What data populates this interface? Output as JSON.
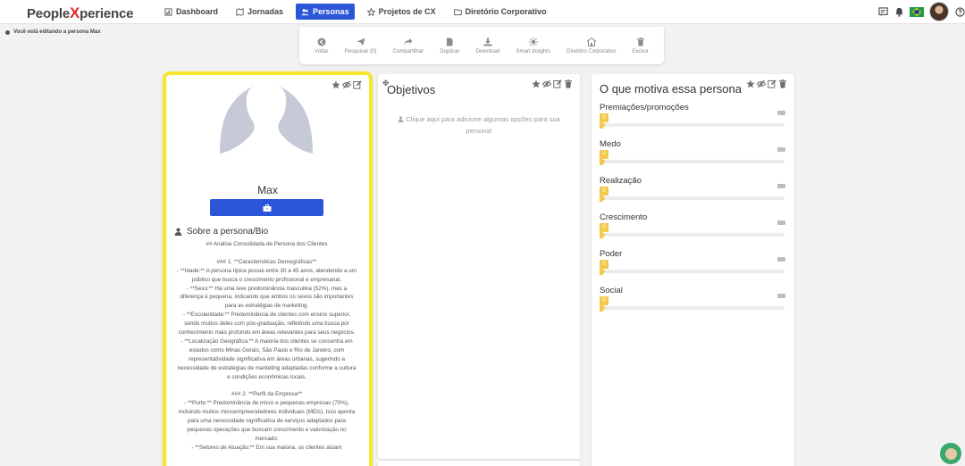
{
  "app": {
    "logo_part1": "People",
    "logo_x": "X",
    "logo_part2": "perience"
  },
  "nav": {
    "items": [
      {
        "label": "Dashboard",
        "icon": "dashboard-icon"
      },
      {
        "label": "Jornadas",
        "icon": "map-icon"
      },
      {
        "label": "Personas",
        "icon": "users-icon",
        "active": true
      },
      {
        "label": "Projetos de CX",
        "icon": "cx-icon"
      },
      {
        "label": "Diretório Corporativo",
        "icon": "folder-icon"
      }
    ]
  },
  "status": {
    "editing_text": "Você está editando a persona Max"
  },
  "toolbar": {
    "items": [
      {
        "label": "Voltar",
        "icon": "back-icon"
      },
      {
        "label": "Pesquisar (0)",
        "icon": "send-icon"
      },
      {
        "label": "Compartilhar",
        "icon": "share-icon"
      },
      {
        "label": "Duplicar",
        "icon": "duplicate-icon"
      },
      {
        "label": "Download",
        "icon": "download-icon"
      },
      {
        "label": "Smart Insights",
        "icon": "insights-icon"
      },
      {
        "label": "Diretório Corporativo",
        "icon": "directory-icon"
      },
      {
        "label": "Excluir",
        "icon": "trash-icon"
      }
    ]
  },
  "persona": {
    "name": "Max",
    "bio_heading": "Sobre a persona/Bio",
    "bio_text": "## Análise Consolidada de Persona dos Clientes\n\n### 1. **Características Demográficas**\n- **Idade:** A persona típica possui entre 30 a 45 anos, atendendo a um público que busca o crescimento profissional e empresarial.\n- **Sexo:** Há uma leve predominância masculina (52%), mas a diferença é pequena, indicando que ambos os sexos são importantes para as estratégias de marketing.\n- **Escolaridade:** Predominância de clientes com ensino superior, sendo muitos deles com pós-graduação, refletindo uma busca por conhecimento mais profundo em áreas relevantes para seus negócios.\n- **Localização Geográfica:** A maioria dos clientes se concentra em estados como Minas Gerais, São Paulo e Rio de Janeiro, com representatividade significativa em áreas urbanas, sugerindo a necessidade de estratégias de marketing adaptadas conforme a cultura e condições econômicas locais.\n\n### 2. **Perfil da Empresa**\n- **Porte:** Predominância de micro e pequenas empresas (70%), incluindo muitos microempreendedores individuais (MEIs). Isso aponta para uma necessidade significativa de serviços adaptados para pequenas operações que buscam crescimento e valorização no mercado.\n- **Setores de Atuação:** Em sua maioria, os clientes atuam"
  },
  "goals": {
    "title": "Objetivos",
    "hint": "Clique aqui para adicione algumas opções para sua persona!"
  },
  "motivations": {
    "title": "O que motiva essa persona",
    "items": [
      {
        "label": "Premiações/promoções",
        "value": "0",
        "level": 0
      },
      {
        "label": "Medo",
        "value": "0",
        "level": 0
      },
      {
        "label": "Realização",
        "value": "0",
        "level": 0
      },
      {
        "label": "Crescimento",
        "value": "0",
        "level": 0
      },
      {
        "label": "Poder",
        "value": "0",
        "level": 0
      },
      {
        "label": "Social",
        "value": "0",
        "level": 0
      }
    ]
  },
  "colors": {
    "primary": "#2b56d8",
    "highlight_border": "#f5e82b",
    "motivation_accent": "#f2c94c",
    "logo_accent": "#e0252b"
  }
}
